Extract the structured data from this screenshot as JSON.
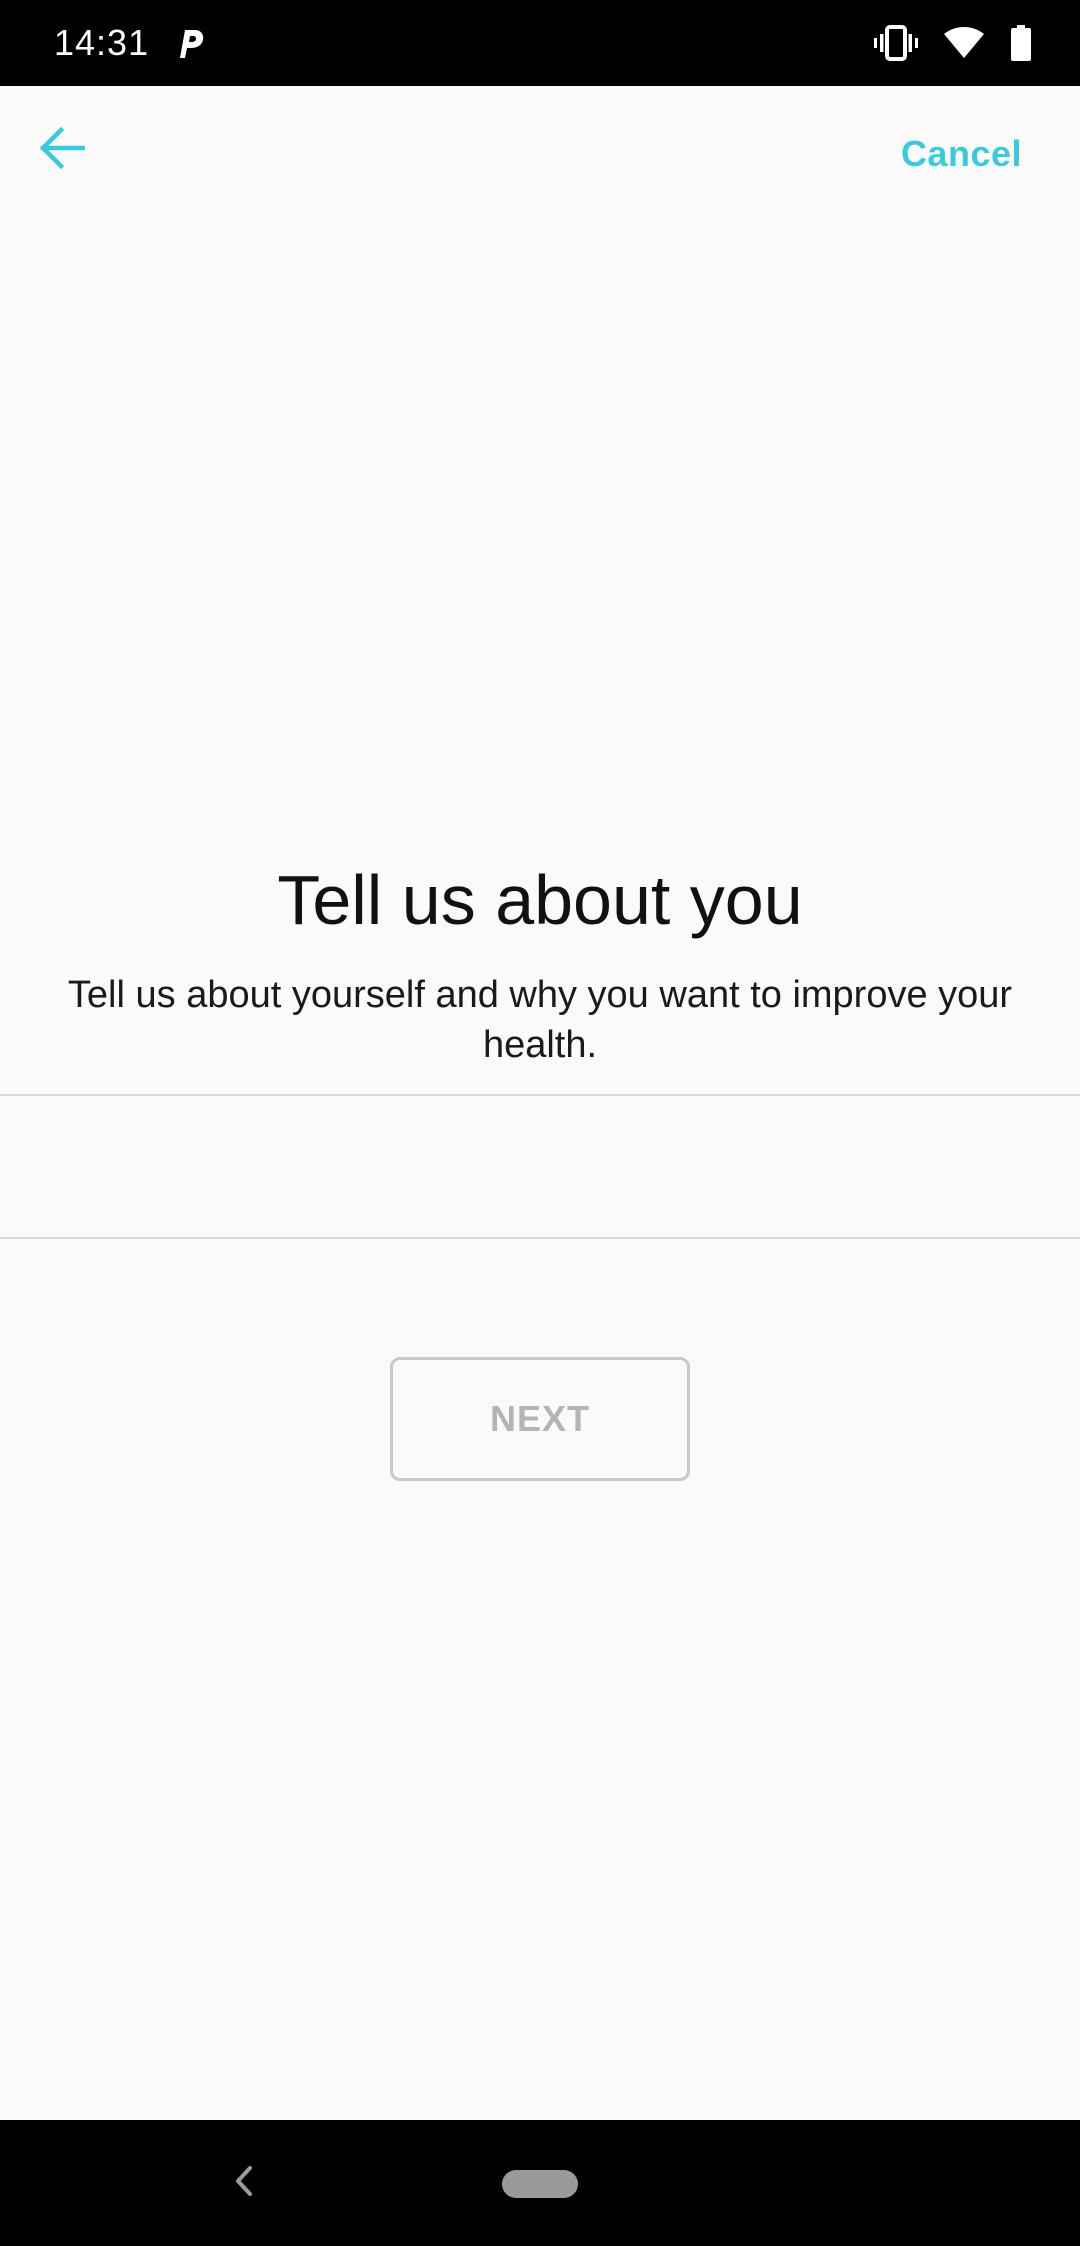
{
  "status_bar": {
    "time": "14:31",
    "icons": [
      "parking-app-icon",
      "vibrate-icon",
      "wifi-icon",
      "battery-icon"
    ]
  },
  "app_bar": {
    "back_icon": "arrow-left-icon",
    "cancel_label": "Cancel",
    "accent_color": "#3ec8dc"
  },
  "content": {
    "title": "Tell us about you",
    "subtitle": "Tell us about yourself and why you want to improve your health.",
    "answer_value": "",
    "answer_placeholder": ""
  },
  "actions": {
    "next_label": "NEXT",
    "next_enabled": false
  },
  "nav_bar": {
    "icons": [
      "nav-back-icon",
      "home-pill-icon"
    ]
  }
}
